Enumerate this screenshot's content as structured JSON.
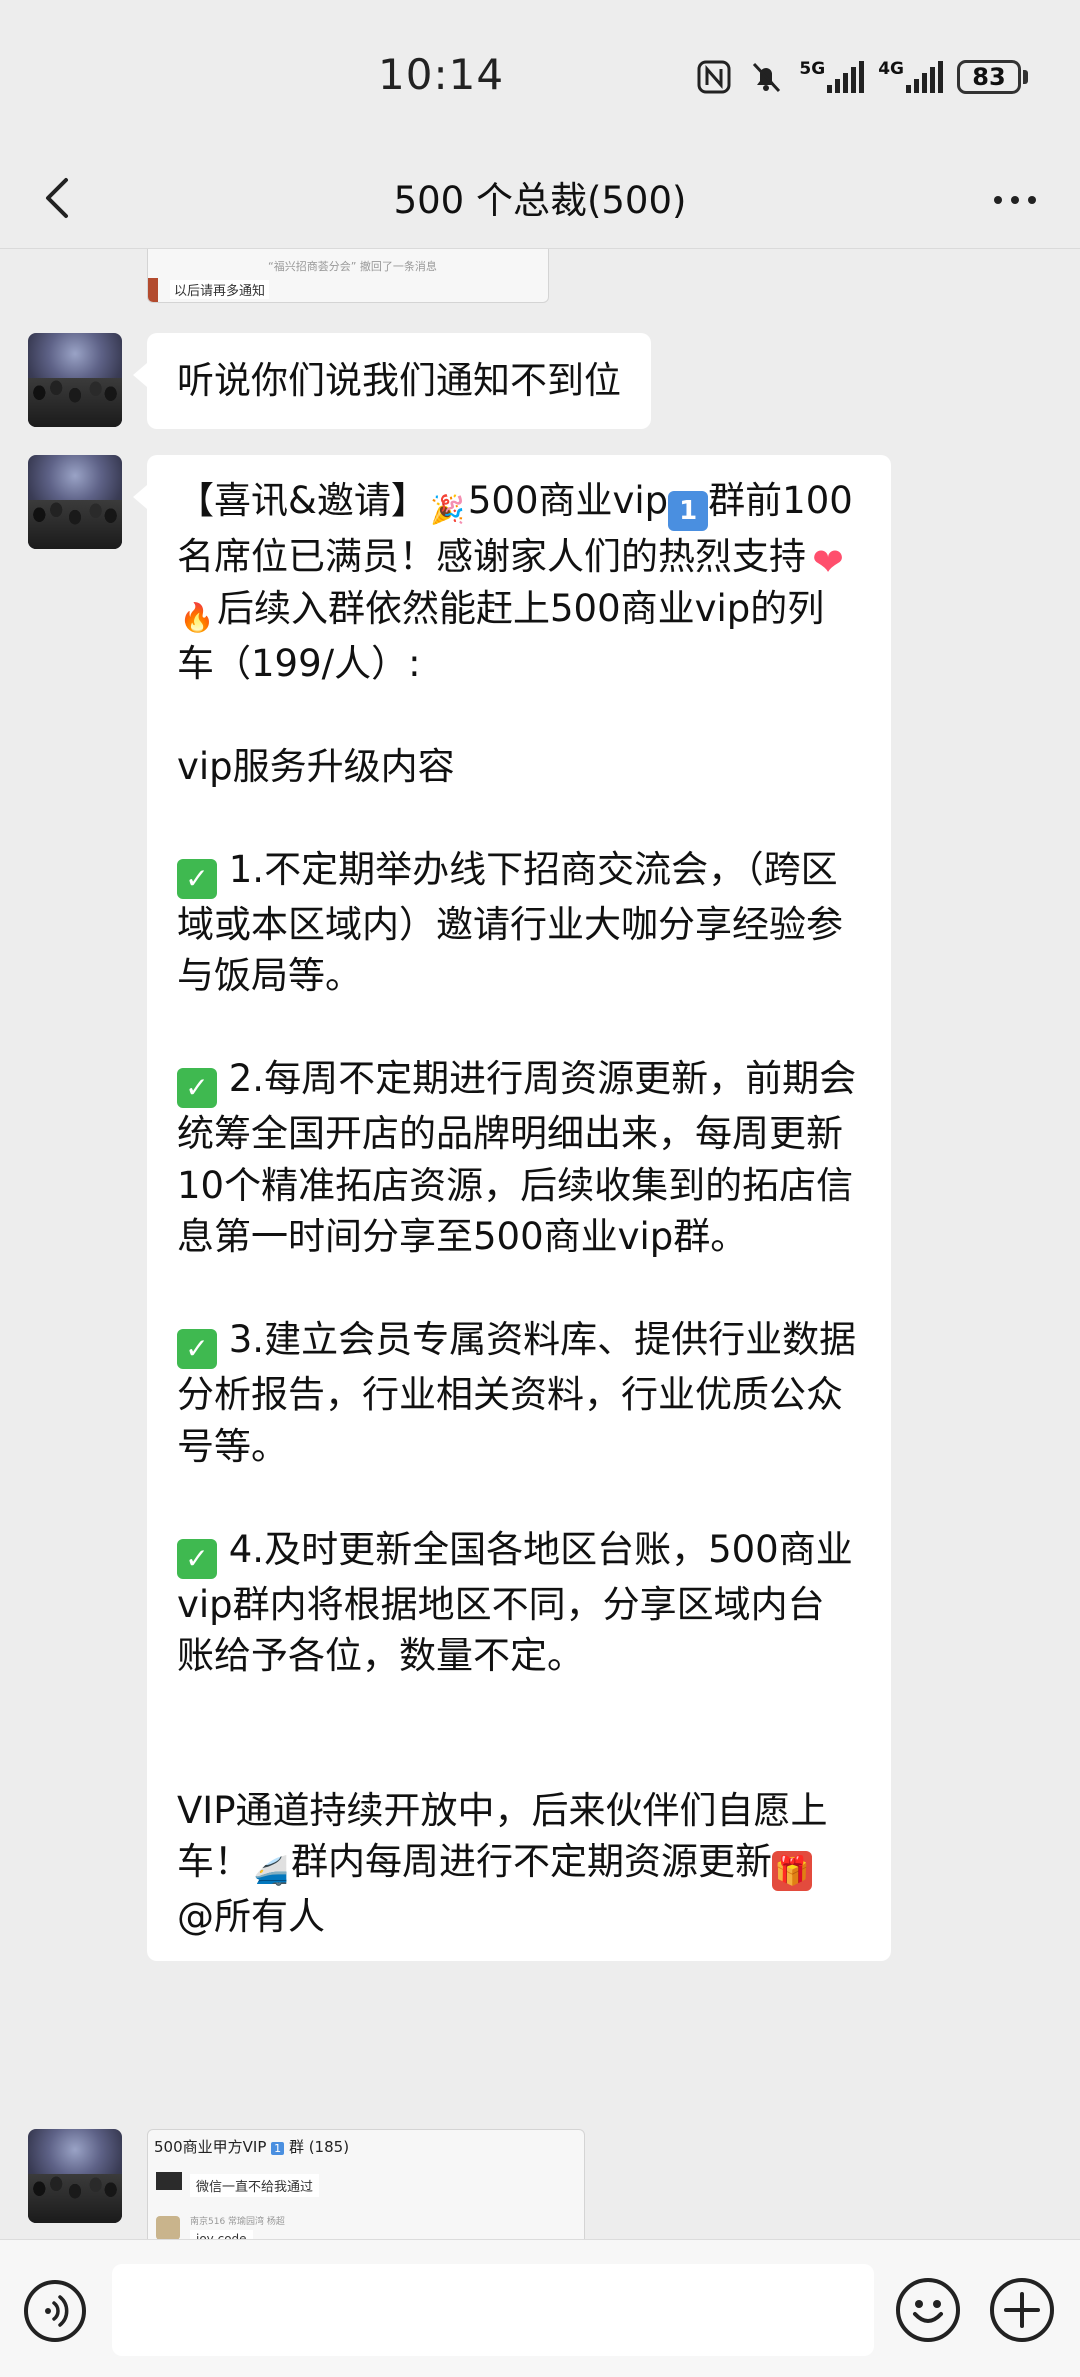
{
  "status_bar": {
    "time": "10:14",
    "network_5g": "5G",
    "network_4g": "4G",
    "battery": "83"
  },
  "header": {
    "title": "500 个总裁(500)",
    "back_icon": "chevron-left-icon",
    "more_icon": "more-dots-icon"
  },
  "top_card": {
    "line1": "“福兴招商荟分会” 撤回了一条消息",
    "line2": "以后请再多通知"
  },
  "messages": [
    {
      "text": "听说你们说我们通知不到位"
    },
    {
      "lines": [
        "【喜讯&邀请】",
        "500商业vip",
        "群前100名席位已满员！感谢家人们的热烈支持",
        "后续入群依然能赶上500商业vip的列车（199/人）:",
        "vip服务升级内容",
        "1.不定期举办线下招商交流会，（跨区域或本区域内）邀请行业大咖分享经验参与饭局等。",
        "2.每周不定期进行周资源更新，前期会统筹全国开店的品牌明细出来，每周更新10个精准拓店资源，后续收集到的拓店信息第一时间分享至500商业vip群。",
        "3.建立会员专属资料库、提供行业数据分析报告，行业相关资料，行业优质公众号等。",
        "4.及时更新全国各地区台账，500商业vip群内将根据地区不同，分享区域内台账给予各位，数量不定。",
        "VIP通道持续开放中，后来伙伴们自愿上车！",
        "群内每周进行不定期资源更新",
        "@所有人"
      ]
    }
  ],
  "bottom_card": {
    "title_a": "500商业甲方VIP",
    "title_b": "群 (185)",
    "row1": "微信一直不给我通过",
    "row2_sub": "南京516 常瑜园湾 杨超",
    "row3": "joy code"
  },
  "input_bar": {
    "voice_icon": "voice-icon",
    "emoji_icon": "smile-icon",
    "plus_icon": "plus-icon"
  }
}
